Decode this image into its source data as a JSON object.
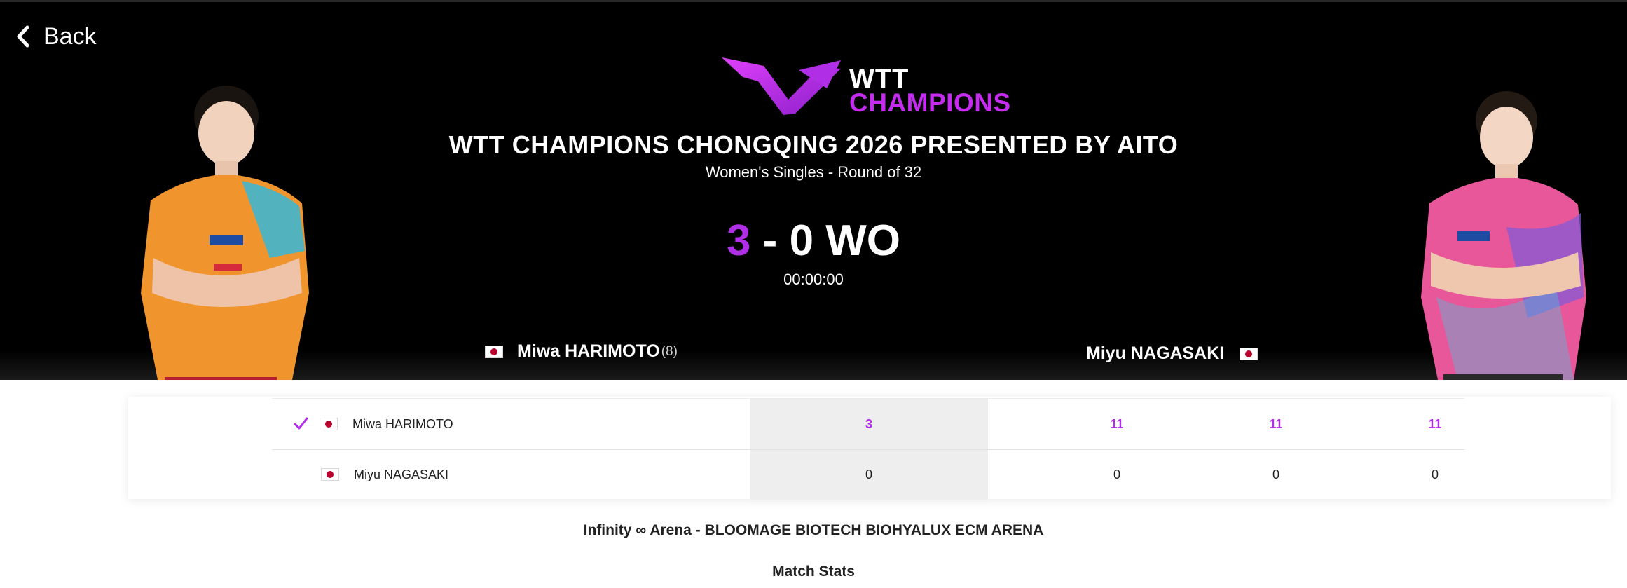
{
  "nav": {
    "back_label": "Back"
  },
  "brand": {
    "word1": "WTT",
    "word2": "CHAMPIONS",
    "accent_color": "#b02ee6"
  },
  "event": {
    "title": "WTT CHAMPIONS CHONGQING 2026 PRESENTED BY AITO",
    "subtitle": "Women's Singles - Round of 32"
  },
  "match": {
    "score_left": "3",
    "score_separator": "-",
    "score_right": "0",
    "result_suffix": "WO",
    "duration": "00:00:00"
  },
  "players": {
    "left": {
      "name": "Miwa HARIMOTO",
      "seed": "(8)",
      "flag_icon": "japan-flag-icon"
    },
    "right": {
      "name": "Miyu NAGASAKI",
      "flag_icon": "japan-flag-icon"
    }
  },
  "scoreboard": {
    "rows": [
      {
        "name": "Miwa HARIMOTO",
        "winner": true,
        "total": "3",
        "games": [
          "11",
          "11",
          "11"
        ]
      },
      {
        "name": "Miyu NAGASAKI",
        "winner": false,
        "total": "0",
        "games": [
          "0",
          "0",
          "0"
        ]
      }
    ]
  },
  "venue": "Infinity ∞ Arena - BLOOMAGE BIOTECH BIOHYALUX ECM ARENA",
  "match_stats_label": "Match Stats"
}
